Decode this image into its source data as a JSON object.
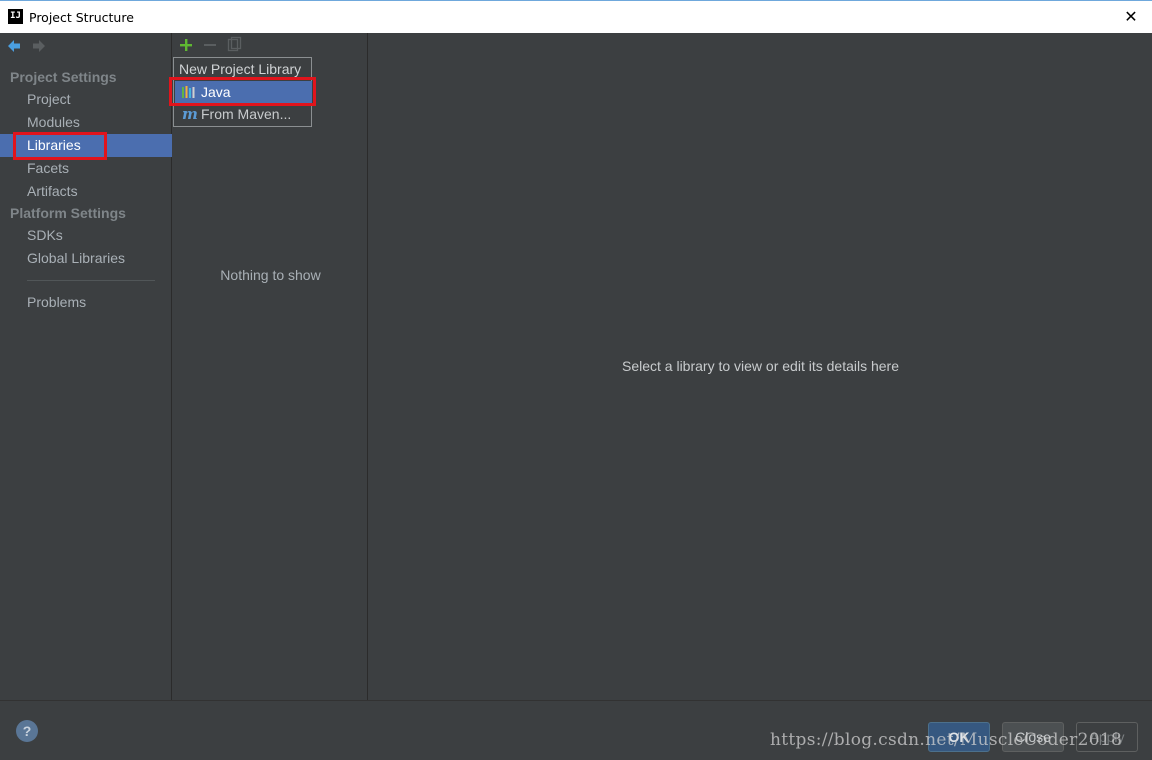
{
  "window": {
    "title": "Project Structure",
    "app_icon_text": "IJ",
    "close_glyph": "✕"
  },
  "sidebar": {
    "project_settings_heading": "Project Settings",
    "project_items": [
      {
        "label": "Project"
      },
      {
        "label": "Modules"
      },
      {
        "label": "Libraries",
        "selected": true
      },
      {
        "label": "Facets"
      },
      {
        "label": "Artifacts"
      }
    ],
    "platform_settings_heading": "Platform Settings",
    "platform_items": [
      {
        "label": "SDKs"
      },
      {
        "label": "Global Libraries"
      }
    ],
    "problems_label": "Problems"
  },
  "libraries_panel": {
    "toolbar": {
      "add_icon": "plus-icon",
      "remove_icon": "minus-icon",
      "copy_icon": "copy-icon"
    },
    "empty_text": "Nothing to show"
  },
  "popup": {
    "title": "New Project Library",
    "items": [
      {
        "label": "Java",
        "icon": "java-library-icon",
        "selected": true
      },
      {
        "label": "From Maven...",
        "icon": "maven-icon"
      }
    ]
  },
  "detail": {
    "placeholder": "Select a library to view or edit its details here"
  },
  "footer": {
    "help": "?",
    "ok_label": "OK",
    "close_label": "Close",
    "apply_label": "Apply",
    "watermark": "https://blog.csdn.net/MuscleCoder2018"
  },
  "colors": {
    "background": "#3c3f41",
    "selection": "#4b6eaf",
    "highlight_box": "#e1141c",
    "add_icon": "#5fb832"
  }
}
